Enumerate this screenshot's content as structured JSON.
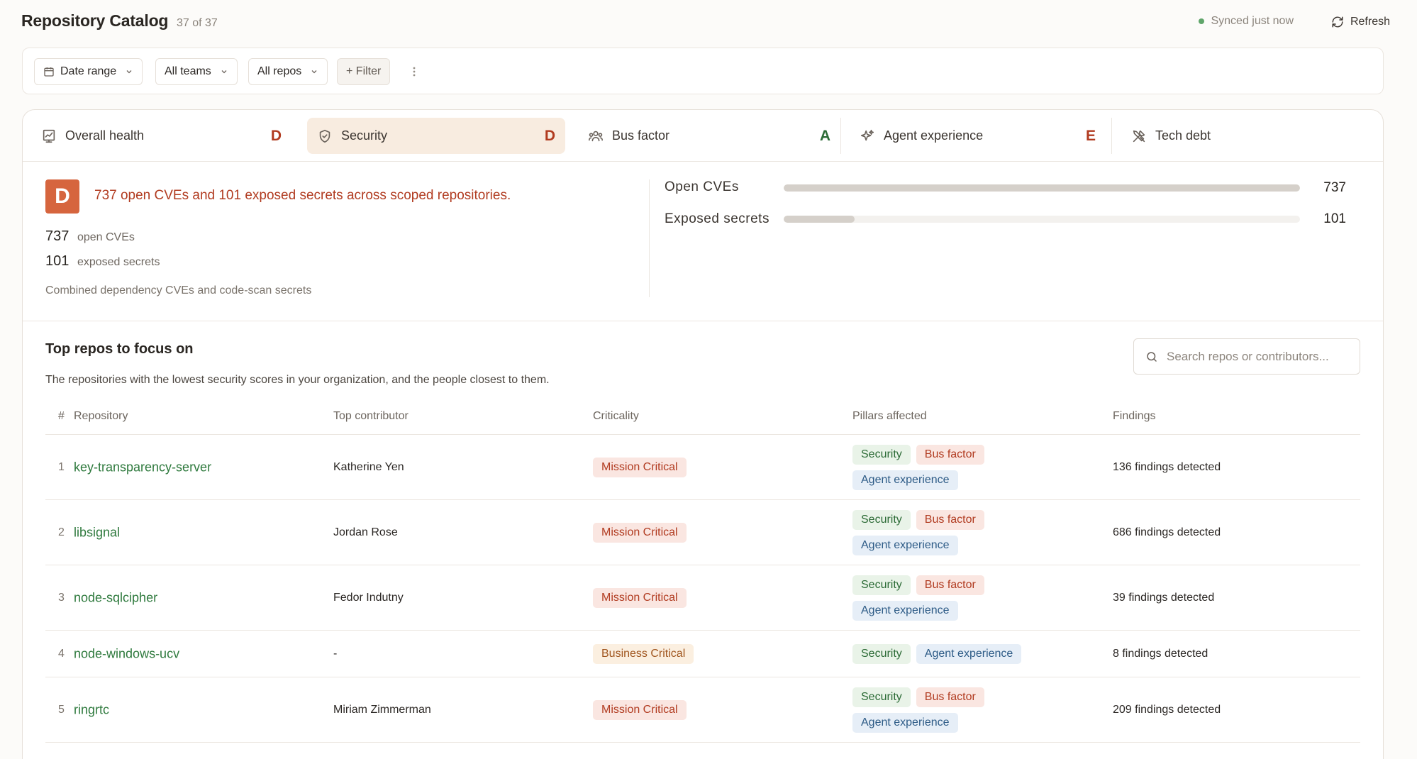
{
  "header": {
    "title": "Repository Catalog",
    "count": "37 of 37",
    "sync_status": "Synced just now",
    "refresh_label": "Refresh"
  },
  "filters": {
    "date_range": "Date range",
    "teams": "All teams",
    "repos": "All repos",
    "add_filter": "+ Filter"
  },
  "tabs": [
    {
      "label": "Overall health",
      "grade": "D",
      "icon": "chart-icon"
    },
    {
      "label": "Security",
      "grade": "D",
      "icon": "shield-icon"
    },
    {
      "label": "Bus factor",
      "grade": "A",
      "icon": "people-icon"
    },
    {
      "label": "Agent experience",
      "grade": "E",
      "icon": "sparkle-icon"
    },
    {
      "label": "Tech debt",
      "grade": "",
      "icon": "tools-icon"
    }
  ],
  "colors": {
    "grade_D": "#b13b20",
    "grade_A": "#2c6b36",
    "grade_E": "#b13b20",
    "badge_bg": "#d6653e",
    "repo_link": "#2f7a3e"
  },
  "summary": {
    "grade": "D",
    "headline": "737 open CVEs and 101 exposed secrets across scoped repositories.",
    "stats": [
      {
        "value": "737",
        "label": "open CVEs"
      },
      {
        "value": "101",
        "label": "exposed secrets"
      }
    ],
    "note": "Combined dependency CVEs and code-scan secrets",
    "bars": [
      {
        "label": "Open CVEs",
        "value": "737",
        "fraction": 1.0
      },
      {
        "label": "Exposed secrets",
        "value": "101",
        "fraction": 0.137
      }
    ]
  },
  "top_repos": {
    "title": "Top repos to focus on",
    "subtitle": "The repositories with the lowest security scores in your organization, and the people closest to them.",
    "search_placeholder": "Search repos or contributors...",
    "columns": [
      "#",
      "Repository",
      "Top contributor",
      "Criticality",
      "Pillars affected",
      "Findings"
    ],
    "rows": [
      {
        "rank": "1",
        "repo": "key-transparency-server",
        "contributor": "Katherine Yen",
        "criticality": "Mission Critical",
        "pillars": [
          "Security",
          "Bus factor",
          "Agent experience"
        ],
        "findings": "136 findings detected"
      },
      {
        "rank": "2",
        "repo": "libsignal",
        "contributor": "Jordan Rose",
        "criticality": "Mission Critical",
        "pillars": [
          "Security",
          "Bus factor",
          "Agent experience"
        ],
        "findings": "686 findings detected"
      },
      {
        "rank": "3",
        "repo": "node-sqlcipher",
        "contributor": "Fedor Indutny",
        "criticality": "Mission Critical",
        "pillars": [
          "Security",
          "Bus factor",
          "Agent experience"
        ],
        "findings": "39 findings detected"
      },
      {
        "rank": "4",
        "repo": "node-windows-ucv",
        "contributor": "-",
        "criticality": "Business Critical",
        "pillars": [
          "Security",
          "Agent experience"
        ],
        "findings": "8 findings detected"
      },
      {
        "rank": "5",
        "repo": "ringrtc",
        "contributor": "Miriam Zimmerman",
        "criticality": "Mission Critical",
        "pillars": [
          "Security",
          "Bus factor",
          "Agent experience"
        ],
        "findings": "209 findings detected"
      }
    ]
  }
}
